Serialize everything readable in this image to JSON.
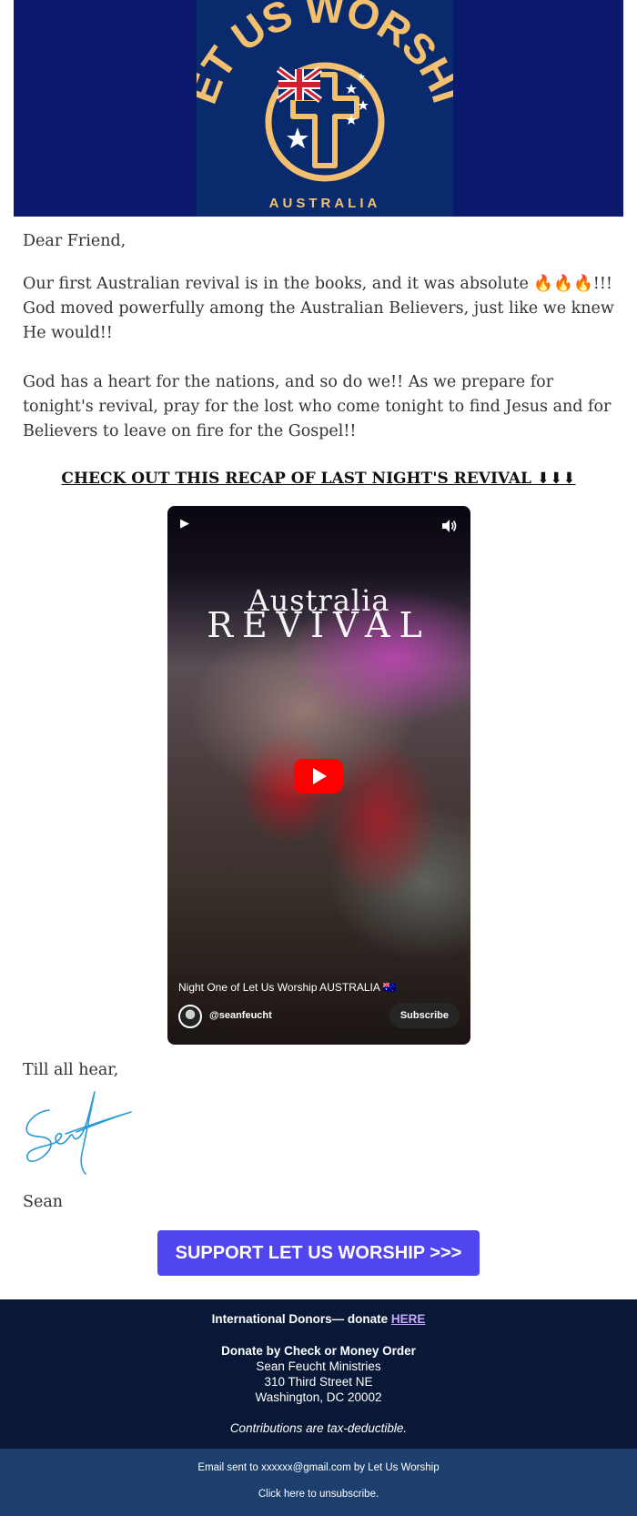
{
  "header": {
    "logo_text": "LET US WORSHIP",
    "logo_subtext": "AUSTRALIA",
    "background": "#0c1a6e",
    "logo_color": "#f3c070"
  },
  "letter": {
    "greeting": "Dear Friend,",
    "paragraph1_before": "Our first Australian revival is in the books, and it was absolute ",
    "paragraph1_emoji": "🔥🔥🔥",
    "paragraph1_after": "!!! God moved powerfully among the Australian Believers, just like we knew He would!!",
    "paragraph2": "God has a heart for the nations, and so do we!! As we prepare for tonight's revival, pray for the lost who come tonight to find Jesus and  for Believers to leave on fire for the Gospel!!",
    "recap_heading": "CHECK OUT THIS RECAP OF LAST NIGHT'S REVIVAL ⬇⬇⬇",
    "signoff": "Till all hear,",
    "signer": "Sean"
  },
  "video": {
    "overlay_line1": "Australia",
    "overlay_line2": "REVIVAL",
    "caption": "Night One of Let Us Worship AUSTRALIA 🇦🇺",
    "channel": "@seanfeucht",
    "subscribe_label": "Subscribe",
    "top_play_icon": "▶"
  },
  "cta": {
    "label": "SUPPORT LET US WORSHIP >>>",
    "color": "#5145ee"
  },
  "footer": {
    "intl_text": "International Donors— donate ",
    "intl_link": "HERE",
    "check_heading": "Donate by Check or Money Order",
    "org": "Sean Feucht Ministries",
    "street": "310 Third Street NE",
    "city": "Washington, DC 20002",
    "tax_note": "Contributions are tax-deductible.",
    "background": "#081836"
  },
  "subfooter": {
    "sent_to": "Email sent to xxxxxx@gmail.com by Let Us Worship",
    "unsubscribe": "Click here to unsubscribe.",
    "background": "#1c3f6e"
  }
}
